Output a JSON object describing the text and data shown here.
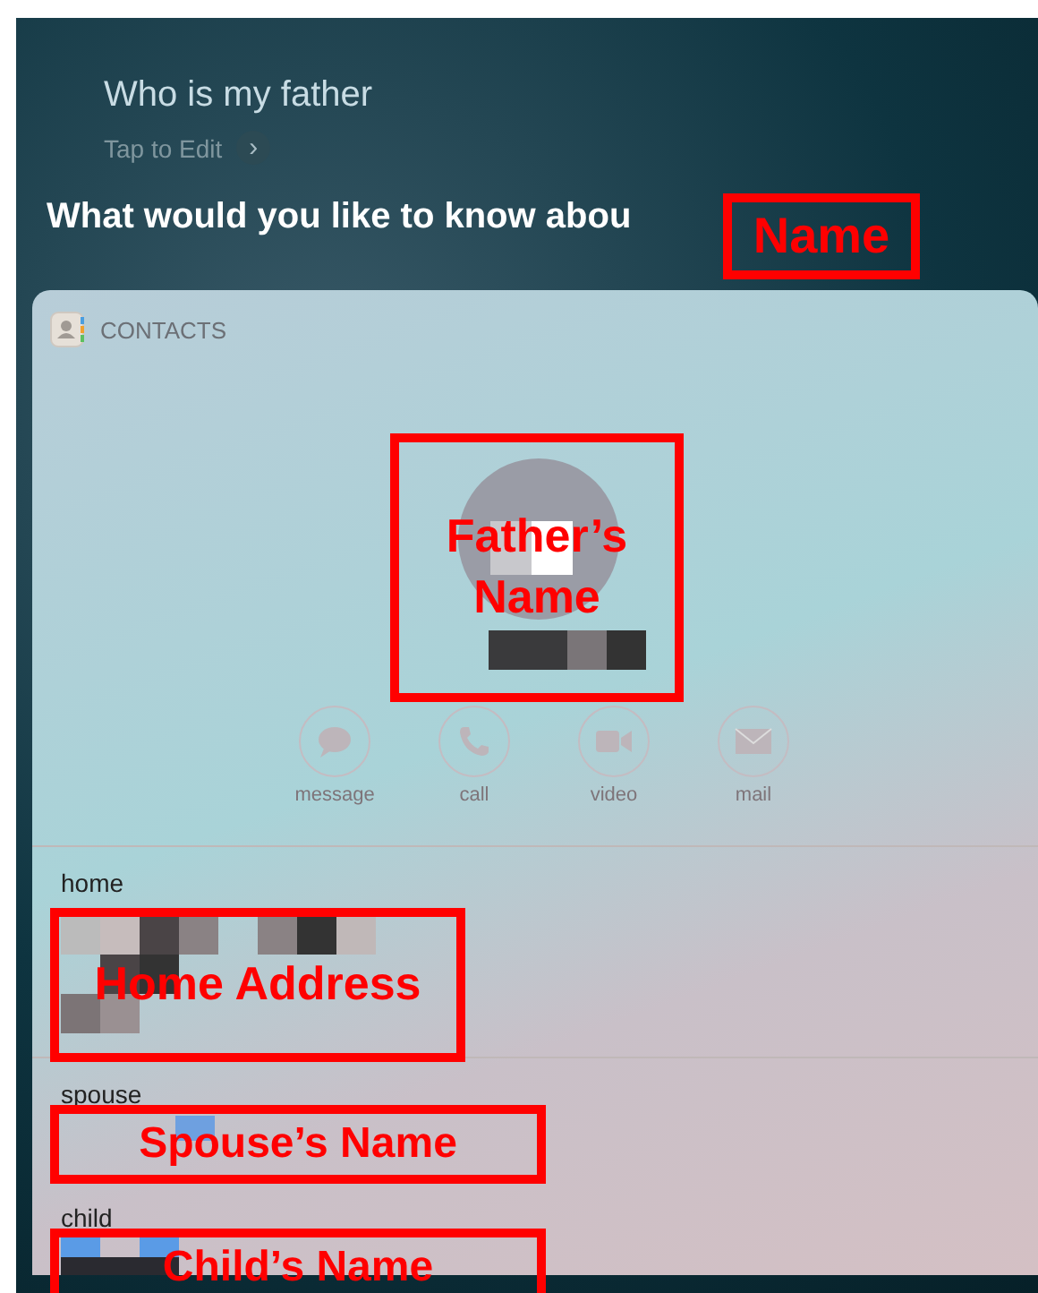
{
  "siri": {
    "query": "Who is my father",
    "edit_hint": "Tap to Edit",
    "chevron": "›",
    "response": "What would you like to know abou"
  },
  "card": {
    "app_name": "CONTACTS",
    "actions": [
      {
        "label": "message",
        "kind": "message"
      },
      {
        "label": "call",
        "kind": "call"
      },
      {
        "label": "video",
        "kind": "video"
      },
      {
        "label": "mail",
        "kind": "mail"
      }
    ],
    "fields": [
      {
        "label": "home"
      },
      {
        "label": "spouse"
      },
      {
        "label": "child"
      }
    ]
  },
  "annotations": [
    {
      "text": "Name"
    },
    {
      "text": "Father’s Name"
    },
    {
      "text": "Home Address"
    },
    {
      "text": "Spouse’s Name"
    },
    {
      "text": "Child’s Name"
    }
  ]
}
